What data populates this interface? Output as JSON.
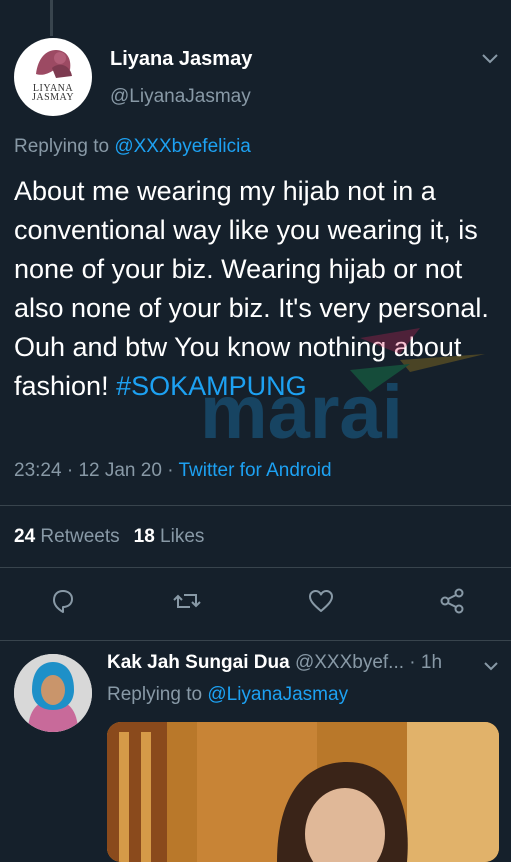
{
  "tweet": {
    "author_name": "Liyana Jasmay",
    "author_handle": "@LiyanaJasmay",
    "avatar_brand_line1": "LIYANA",
    "avatar_brand_line2": "JASMAY",
    "replying_prefix": "Replying to ",
    "replying_mention": "@XXXbyefelicia",
    "text_body": "About me wearing my hijab not in a conventional way like you wearing it, is none of your biz. Wearing hijab or not also none of your biz. It's very personal. Ouh and btw You know nothing about fashion! ",
    "hashtag": "#SOKAMPUNG",
    "time": "23:24",
    "date": "12 Jan 20",
    "separator": "·",
    "source": "Twitter for Android",
    "retweets_count": "24",
    "retweets_label": "Retweets",
    "likes_count": "18",
    "likes_label": "Likes"
  },
  "reply": {
    "author_name": "Kak Jah Sungai Dua",
    "author_handle_time": "@XXXbyef... · 1h",
    "replying_prefix": "Replying to ",
    "replying_mention": "@LiyanaJasmay"
  },
  "colors": {
    "background": "#15202b",
    "accent": "#1da1f2",
    "secondary_text": "#8899a6",
    "divider": "#38444d"
  },
  "icons": [
    "chevron-down-icon",
    "reply-icon",
    "retweet-icon",
    "like-icon",
    "share-icon"
  ]
}
